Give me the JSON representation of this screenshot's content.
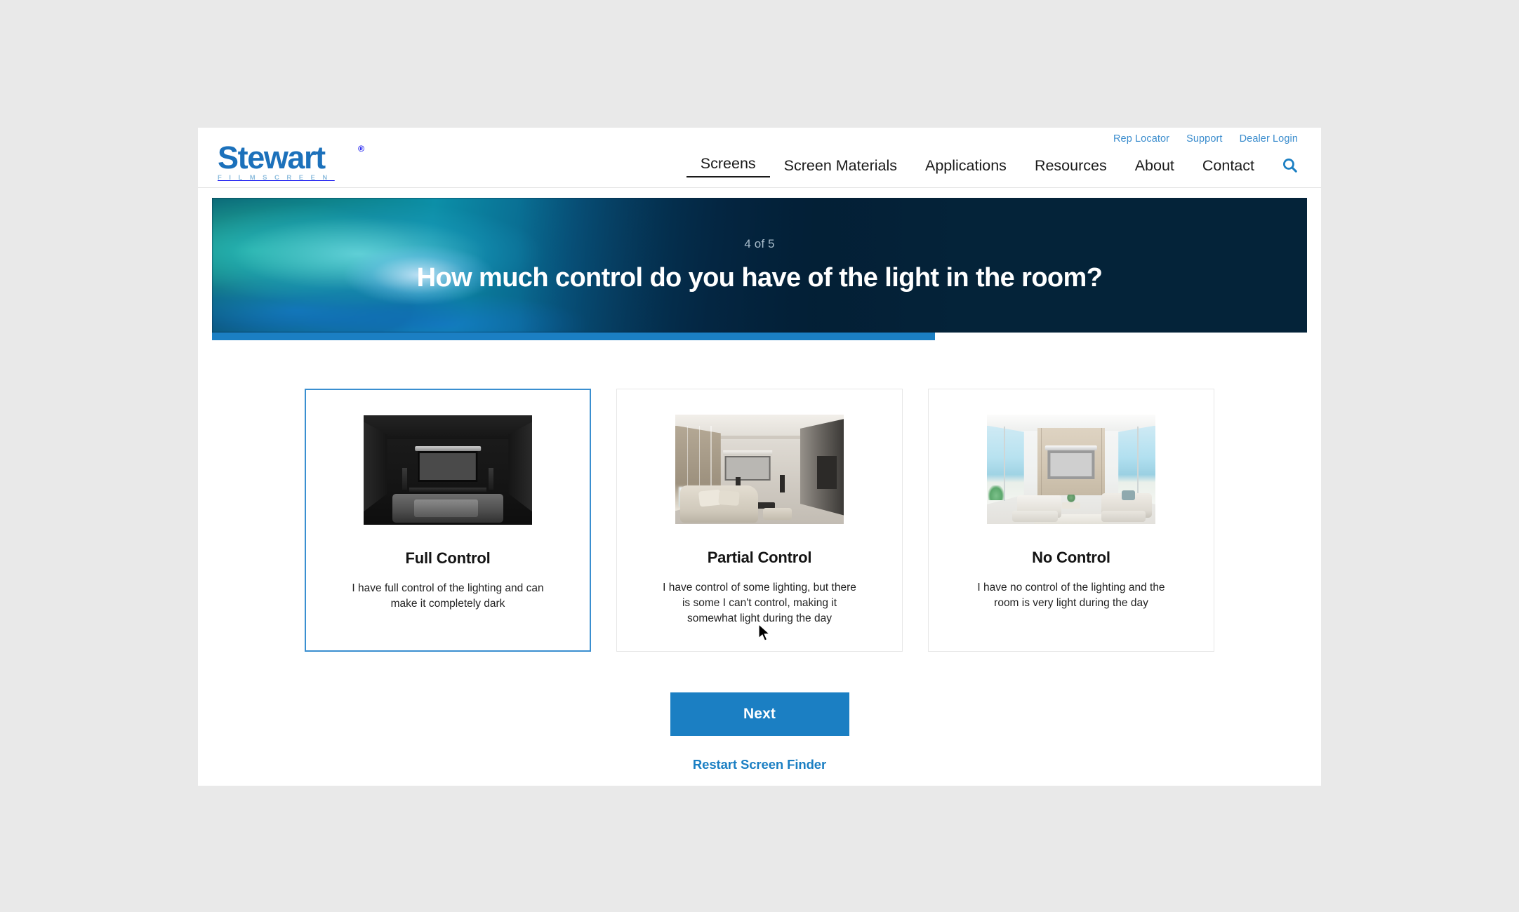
{
  "brand": {
    "name": "Stewart",
    "registered": "®",
    "tagline": "FILMSCREEN"
  },
  "utility_nav": {
    "items": [
      {
        "label": "Rep Locator"
      },
      {
        "label": "Support"
      },
      {
        "label": "Dealer Login"
      }
    ]
  },
  "main_nav": {
    "items": [
      {
        "label": "Screens",
        "active": true
      },
      {
        "label": "Screen Materials",
        "active": false
      },
      {
        "label": "Applications",
        "active": false
      },
      {
        "label": "Resources",
        "active": false
      },
      {
        "label": "About",
        "active": false
      },
      {
        "label": "Contact",
        "active": false
      }
    ],
    "search_icon": "search-icon"
  },
  "hero": {
    "step_counter": "4 of 5",
    "question": "How much control do you have of the light in the room?",
    "progress_percent": 66
  },
  "options": [
    {
      "title": "Full Control",
      "description": "I have full control of the lighting and can make it completely dark",
      "image_alt": "dark-home-theater-room",
      "selected": true
    },
    {
      "title": "Partial Control",
      "description": "I have control of some lighting, but there is some I can't control, making it somewhat light during the day",
      "image_alt": "dimly-lit-room-with-shades",
      "selected": false
    },
    {
      "title": "No Control",
      "description": "I have no control of the lighting and the room is very light during the day",
      "image_alt": "bright-sunlit-room-with-windows",
      "selected": false
    }
  ],
  "actions": {
    "next_label": "Next",
    "restart_label": "Restart Screen Finder"
  },
  "colors": {
    "accent_blue": "#1b7fc3",
    "link_blue": "#3a8ccd",
    "logo_blue": "#1c71bb",
    "selected_border": "#3a8fd0",
    "hero_dark": "#042339",
    "page_background": "#e9e9e9"
  }
}
